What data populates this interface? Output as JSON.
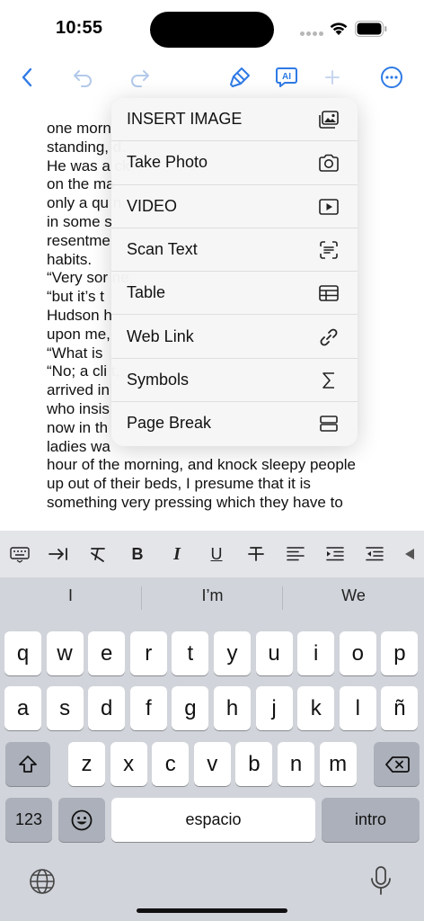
{
  "status": {
    "time": "10:55"
  },
  "document": {
    "lines": [
      "one morn",
      "standing,                                                  d.",
      "He was a                                                ck",
      "on the ma",
      "only a qu                                                n",
      "in some s",
      "resentme",
      "habits.",
      "“Very sor                                              ne,",
      "“but it’s t",
      "Hudson h",
      "upon me,",
      "“What is",
      "“No; a cli                                                t,",
      "arrived in",
      "who insis",
      "now in th",
      "ladies wa",
      "hour of the morning, and knock sleepy people",
      "up out of their beds, I presume that it is",
      "something very pressing which they have to"
    ]
  },
  "menu": {
    "items": [
      {
        "label": "INSERT IMAGE",
        "icon": "photo-icon"
      },
      {
        "label": "Take Photo",
        "icon": "camera-icon"
      },
      {
        "label": "VIDEO",
        "icon": "video-icon"
      },
      {
        "label": "Scan Text",
        "icon": "scan-text-icon"
      },
      {
        "label": "Table",
        "icon": "table-icon"
      },
      {
        "label": "Web Link",
        "icon": "link-icon"
      },
      {
        "label": "Symbols",
        "icon": "sigma-icon"
      },
      {
        "label": "Page Break",
        "icon": "page-break-icon"
      }
    ]
  },
  "format_bar": {
    "bold": "B",
    "italic": "I",
    "underline": "U"
  },
  "predictions": [
    "I",
    "I’m",
    "We"
  ],
  "keyboard": {
    "row1": [
      "q",
      "w",
      "e",
      "r",
      "t",
      "y",
      "u",
      "i",
      "o",
      "p"
    ],
    "row2": [
      "a",
      "s",
      "d",
      "f",
      "g",
      "h",
      "j",
      "k",
      "l",
      "ñ"
    ],
    "row3": [
      "z",
      "x",
      "c",
      "v",
      "b",
      "n",
      "m"
    ],
    "numbers_label": "123",
    "space_label": "espacio",
    "return_label": "intro"
  },
  "colors": {
    "accent": "#2f7ae5",
    "menu_bg": "#f6f6f6",
    "keyboard_bg": "#d1d4da"
  }
}
